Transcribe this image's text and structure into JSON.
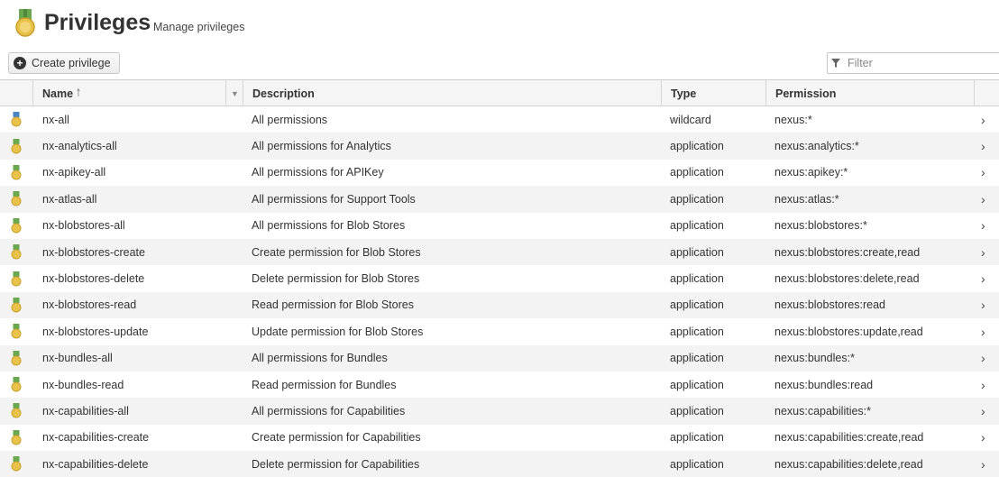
{
  "header": {
    "title": "Privileges",
    "subtitle": "Manage privileges"
  },
  "toolbar": {
    "create_label": "Create privilege",
    "filter_placeholder": "Filter"
  },
  "columns": {
    "name": "Name",
    "description": "Description",
    "type": "Type",
    "permission": "Permission"
  },
  "colors": {
    "medal_gold": "#e8c24a",
    "ribbon_green": "#6aa84f",
    "ribbon_blue": "#4a86c5"
  },
  "rows": [
    {
      "name": "nx-all",
      "description": "All permissions",
      "type": "wildcard",
      "permission": "nexus:*",
      "ribbon": "blue",
      "arrow": "›"
    },
    {
      "name": "nx-analytics-all",
      "description": "All permissions for Analytics",
      "type": "application",
      "permission": "nexus:analytics:*",
      "ribbon": "green",
      "arrow": "›"
    },
    {
      "name": "nx-apikey-all",
      "description": "All permissions for APIKey",
      "type": "application",
      "permission": "nexus:apikey:*",
      "ribbon": "green",
      "arrow": "›"
    },
    {
      "name": "nx-atlas-all",
      "description": "All permissions for Support Tools",
      "type": "application",
      "permission": "nexus:atlas:*",
      "ribbon": "green",
      "arrow": "›"
    },
    {
      "name": "nx-blobstores-all",
      "description": "All permissions for Blob Stores",
      "type": "application",
      "permission": "nexus:blobstores:*",
      "ribbon": "green",
      "arrow": "›"
    },
    {
      "name": "nx-blobstores-create",
      "description": "Create permission for Blob Stores",
      "type": "application",
      "permission": "nexus:blobstores:create,read",
      "ribbon": "green",
      "arrow": "›"
    },
    {
      "name": "nx-blobstores-delete",
      "description": "Delete permission for Blob Stores",
      "type": "application",
      "permission": "nexus:blobstores:delete,read",
      "ribbon": "green",
      "arrow": "›"
    },
    {
      "name": "nx-blobstores-read",
      "description": "Read permission for Blob Stores",
      "type": "application",
      "permission": "nexus:blobstores:read",
      "ribbon": "green",
      "arrow": "›"
    },
    {
      "name": "nx-blobstores-update",
      "description": "Update permission for Blob Stores",
      "type": "application",
      "permission": "nexus:blobstores:update,read",
      "ribbon": "green",
      "arrow": "›"
    },
    {
      "name": "nx-bundles-all",
      "description": "All permissions for Bundles",
      "type": "application",
      "permission": "nexus:bundles:*",
      "ribbon": "green",
      "arrow": "›"
    },
    {
      "name": "nx-bundles-read",
      "description": "Read permission for Bundles",
      "type": "application",
      "permission": "nexus:bundles:read",
      "ribbon": "green",
      "arrow": "›"
    },
    {
      "name": "nx-capabilities-all",
      "description": "All permissions for Capabilities",
      "type": "application",
      "permission": "nexus:capabilities:*",
      "ribbon": "green",
      "arrow": "›"
    },
    {
      "name": "nx-capabilities-create",
      "description": "Create permission for Capabilities",
      "type": "application",
      "permission": "nexus:capabilities:create,read",
      "ribbon": "green",
      "arrow": "›"
    },
    {
      "name": "nx-capabilities-delete",
      "description": "Delete permission for Capabilities",
      "type": "application",
      "permission": "nexus:capabilities:delete,read",
      "ribbon": "green",
      "arrow": "›"
    }
  ]
}
